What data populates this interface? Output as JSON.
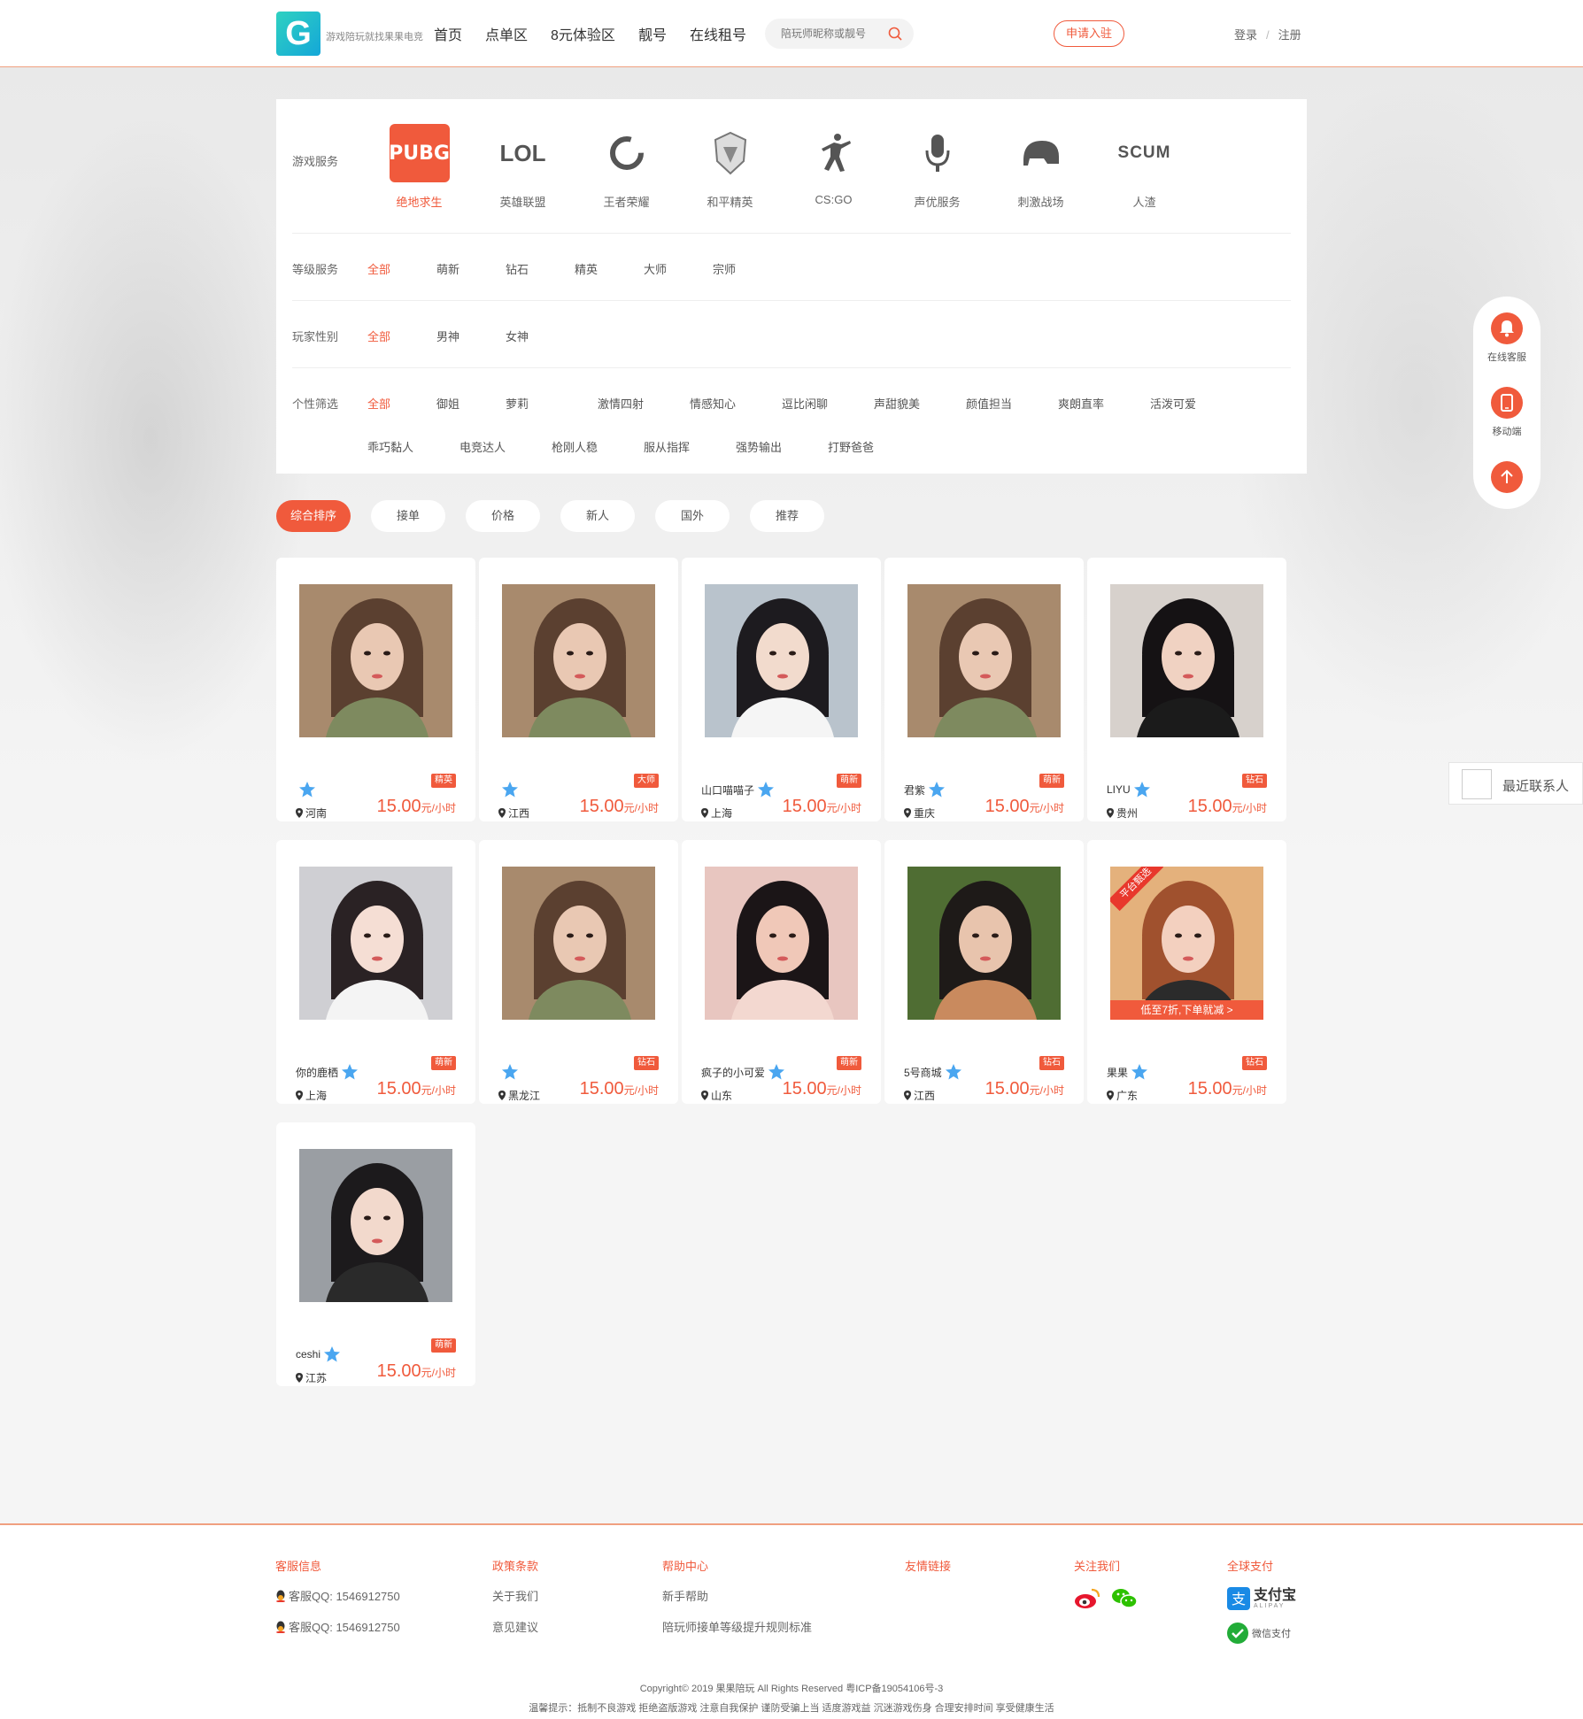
{
  "colors": {
    "accent": "#f05a3c",
    "star": "#4aa6f0"
  },
  "header": {
    "logo_text": "游戏陪玩就找果果电竞",
    "nav": [
      "首页",
      "点单区",
      "8元体验区",
      "靓号",
      "在线租号"
    ],
    "search_placeholder": "陪玩师昵称或靓号",
    "apply_label": "申请入驻",
    "login": "登录",
    "sep": "/",
    "register": "注册"
  },
  "filters": {
    "game_label": "游戏服务",
    "games": [
      {
        "name": "绝地求生",
        "icon": "pubg-icon",
        "logo": "PUBG"
      },
      {
        "name": "英雄联盟",
        "icon": "lol-icon",
        "logo": "LOL"
      },
      {
        "name": "王者荣耀",
        "icon": "honor-of-kings-icon",
        "logo": ""
      },
      {
        "name": "和平精英",
        "icon": "peace-elite-icon",
        "logo": ""
      },
      {
        "name": "CS:GO",
        "icon": "csgo-icon",
        "logo": ""
      },
      {
        "name": "声优服务",
        "icon": "microphone-icon",
        "logo": ""
      },
      {
        "name": "刺激战场",
        "icon": "helmet-icon",
        "logo": ""
      },
      {
        "name": "人渣",
        "icon": "scum-icon",
        "logo": "SCUM"
      }
    ],
    "level_label": "等级服务",
    "levels": [
      "全部",
      "萌新",
      "钻石",
      "精英",
      "大师",
      "宗师"
    ],
    "gender_label": "玩家性别",
    "genders": [
      "全部",
      "男神",
      "女神"
    ],
    "personality_label": "个性筛选",
    "personality": [
      "全部",
      "御姐",
      "萝莉",
      "激情四射",
      "情感知心",
      "逗比闲聊",
      "声甜貌美",
      "颜值担当",
      "爽朗直率",
      "活泼可爱",
      "乖巧黏人",
      "电竞达人",
      "枪刚人稳",
      "服从指挥",
      "强势输出",
      "打野爸爸"
    ]
  },
  "sorts": [
    "综合排序",
    "接单",
    "价格",
    "新人",
    "国外",
    "推荐"
  ],
  "cards": [
    {
      "nick": "",
      "badge": "精英",
      "loc": "河南",
      "price": "15.00",
      "unit": "元/小时",
      "photo": "a"
    },
    {
      "nick": "",
      "badge": "大师",
      "loc": "江西",
      "price": "15.00",
      "unit": "元/小时",
      "photo": "a"
    },
    {
      "nick": "山口喵喵子",
      "badge": "萌新",
      "loc": "上海",
      "price": "15.00",
      "unit": "元/小时",
      "photo": "b"
    },
    {
      "nick": "君紫",
      "badge": "萌新",
      "loc": "重庆",
      "price": "15.00",
      "unit": "元/小时",
      "photo": "a"
    },
    {
      "nick": "LIYU",
      "badge": "钻石",
      "loc": "贵州",
      "price": "15.00",
      "unit": "元/小时",
      "photo": "c"
    },
    {
      "nick": "你的鹿栖",
      "badge": "萌新",
      "loc": "上海",
      "price": "15.00",
      "unit": "元/小时",
      "photo": "d"
    },
    {
      "nick": "",
      "badge": "钻石",
      "loc": "黑龙江",
      "price": "15.00",
      "unit": "元/小时",
      "photo": "a"
    },
    {
      "nick": "疯子的小可爱",
      "badge": "萌新",
      "loc": "山东",
      "price": "15.00",
      "unit": "元/小时",
      "photo": "e"
    },
    {
      "nick": "5号商城",
      "badge": "钻石",
      "loc": "江西",
      "price": "15.00",
      "unit": "元/小时",
      "photo": "f"
    },
    {
      "nick": "果果",
      "badge": "钻石",
      "loc": "广东",
      "price": "15.00",
      "unit": "元/小时",
      "photo": "g",
      "ribbon": "平台甄选",
      "promo": "低至7折,下单就减 >"
    },
    {
      "nick": "ceshi",
      "badge": "萌新",
      "loc": "江苏",
      "price": "15.00",
      "unit": "元/小时",
      "photo": "h"
    }
  ],
  "side": {
    "service": "在线客服",
    "mobile": "移动端"
  },
  "recent_contacts": "最近联系人",
  "footer": {
    "service_title": "客服信息",
    "qq1": "客服QQ: 1546912750",
    "qq2": "客服QQ: 1546912750",
    "policy_title": "政策条款",
    "about": "关于我们",
    "feedback": "意见建议",
    "help_title": "帮助中心",
    "newbie": "新手帮助",
    "rules": "陪玩师接单等级提升规则标准",
    "links_title": "友情链接",
    "follow_title": "关注我们",
    "pay_title": "全球支付",
    "alipay": "支付宝",
    "alipay_en": "ALIPAY",
    "wechat_pay": "微信支付",
    "copyright": "Copyright© 2019 果果陪玩 All Rights Reserved 粤ICP备19054106号-3",
    "tip": "温馨提示：抵制不良游戏 拒绝盗版游戏 注意自我保护 谨防受骗上当 适度游戏益 沉迷游戏伤身 合理安排时间 享受健康生活"
  }
}
